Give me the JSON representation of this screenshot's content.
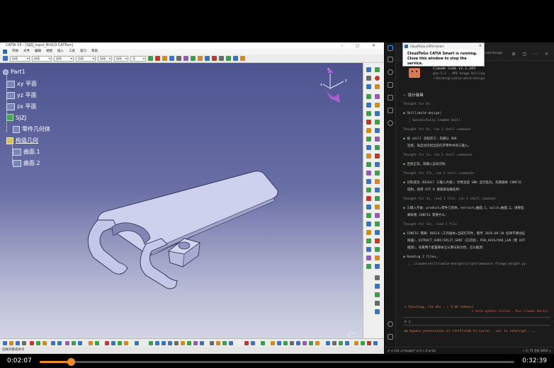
{
  "catia": {
    "title": "CATIA V5 - [SJZJ_input_BUILD.CATPart]",
    "menus": [
      "开始",
      "文件",
      "编辑",
      "视图",
      "插入",
      "工具",
      "窗口",
      "帮助"
    ],
    "combos": [
      "自动",
      "自动",
      "自动",
      "自动",
      "自动",
      "自动",
      "无"
    ],
    "tree": {
      "root": "Part1",
      "planes": [
        "xy 平面",
        "yz 平面",
        "zx 平面"
      ],
      "body": "SJZJ",
      "part_body": "零件几何体",
      "geo_set": "构造几何",
      "surfaces": [
        "曲面.1",
        "曲面.2"
      ]
    },
    "status": "选择对象或命令"
  },
  "popup": {
    "title": "CloudToGo CATIA Smart",
    "close": "×",
    "line1": "CloudToGo CATIA Smart is running.",
    "line2": "Close this window to stop the service."
  },
  "vscode": {
    "tab": "catia-mold-design",
    "header": {
      "name": "Claude Code v2.1.205",
      "model": "glm-5.1 · API Usage Billing",
      "path": "~\\Desktop\\catia-mold-design"
    },
    "section": "› 设计级具",
    "lines": [
      {
        "kind": "dim",
        "text": "Thought for 0s"
      },
      {
        "kind": "bul",
        "text": "Skill(mold-design)"
      },
      {
        "kind": "sub",
        "text": "⎿ Successfully loaded skill"
      },
      {
        "kind": "dim",
        "text": "Thought for 6s, ran 1 shell command"
      },
      {
        "kind": "bul",
        "text": "按 skill 流程开工：先确认 SDK"
      },
      {
        "kind": "plain",
        "text": "连接，再自动识别当前打开零件中的三输入。"
      },
      {
        "kind": "dim",
        "text": "Thought for 1s, ran 2 shell commands"
      },
      {
        "kind": "bul",
        "text": "连接正常。现输入自动识别："
      },
      {
        "kind": "dim",
        "text": "Thought for 17s, ran 2 shell commands"
      },
      {
        "kind": "bul",
        "text": "识别成功（RESULT 三输入齐备）；控制台是 GBK 显示乱码。先看脚本 CONFIG"
      },
      {
        "kind": "plain",
        "text": "结构，再用 UTF-8 重跑拿准确名称："
      },
      {
        "kind": "dim",
        "text": "Thought for 3s, read 1 file, ran 1 shell command"
      },
      {
        "kind": "bul",
        "text": "三输入齐备：product=零件几何体，extract=曲面.1，split=曲面.2。请看怪"
      },
      {
        "kind": "plain",
        "text": "脚本看 CONFIG 需要什么："
      },
      {
        "kind": "dim",
        "text": "Thought for 51s, read 1 file"
      },
      {
        "kind": "bul",
        "text": "CONFIG 需填：BUILD（工作副本=当前打开件，需传 2026-08-20 纪律不要动征"
      },
      {
        "kind": "plain",
        "text": "择器）、EXTRACT_SURF/SPLIT_SURF（已识别）、PIN_AXIS/PAD_LEN（需 OCP"
      },
      {
        "kind": "plain",
        "text": "推测）。先看两个配置脚本怎么算法的文档，怎么推测："
      },
      {
        "kind": "bul",
        "text": "Reading 2 files…"
      },
      {
        "kind": "sub",
        "text": "⎿ .claude\\skills\\mold-design\\scripts\\measure_flange_height.py"
      }
    ],
    "twisting": "✶ Twisting… (1m 41s · ↓ 3.4k tokens)",
    "autoupdate": "✗ Auto-update failed · Run claude doctor",
    "prompt": "> ▯",
    "bypass": "⏵⏵ bypass permissions on (shift+tab to cycle) · esc to interrupt · …",
    "status_left": "✗ ⊙ CUI  ⎇ master*  ⊘ 0 ⚠ 0  ⊕ Go",
    "status_right": "⚐ 行 75 字符 2659 ♫"
  },
  "player": {
    "current": "0:02:07",
    "total": "0:32:39",
    "progress": 0.065
  },
  "colors": {
    "accent": "#f08a2c",
    "claude_orange": "#d87a55",
    "error": "#e05555"
  }
}
